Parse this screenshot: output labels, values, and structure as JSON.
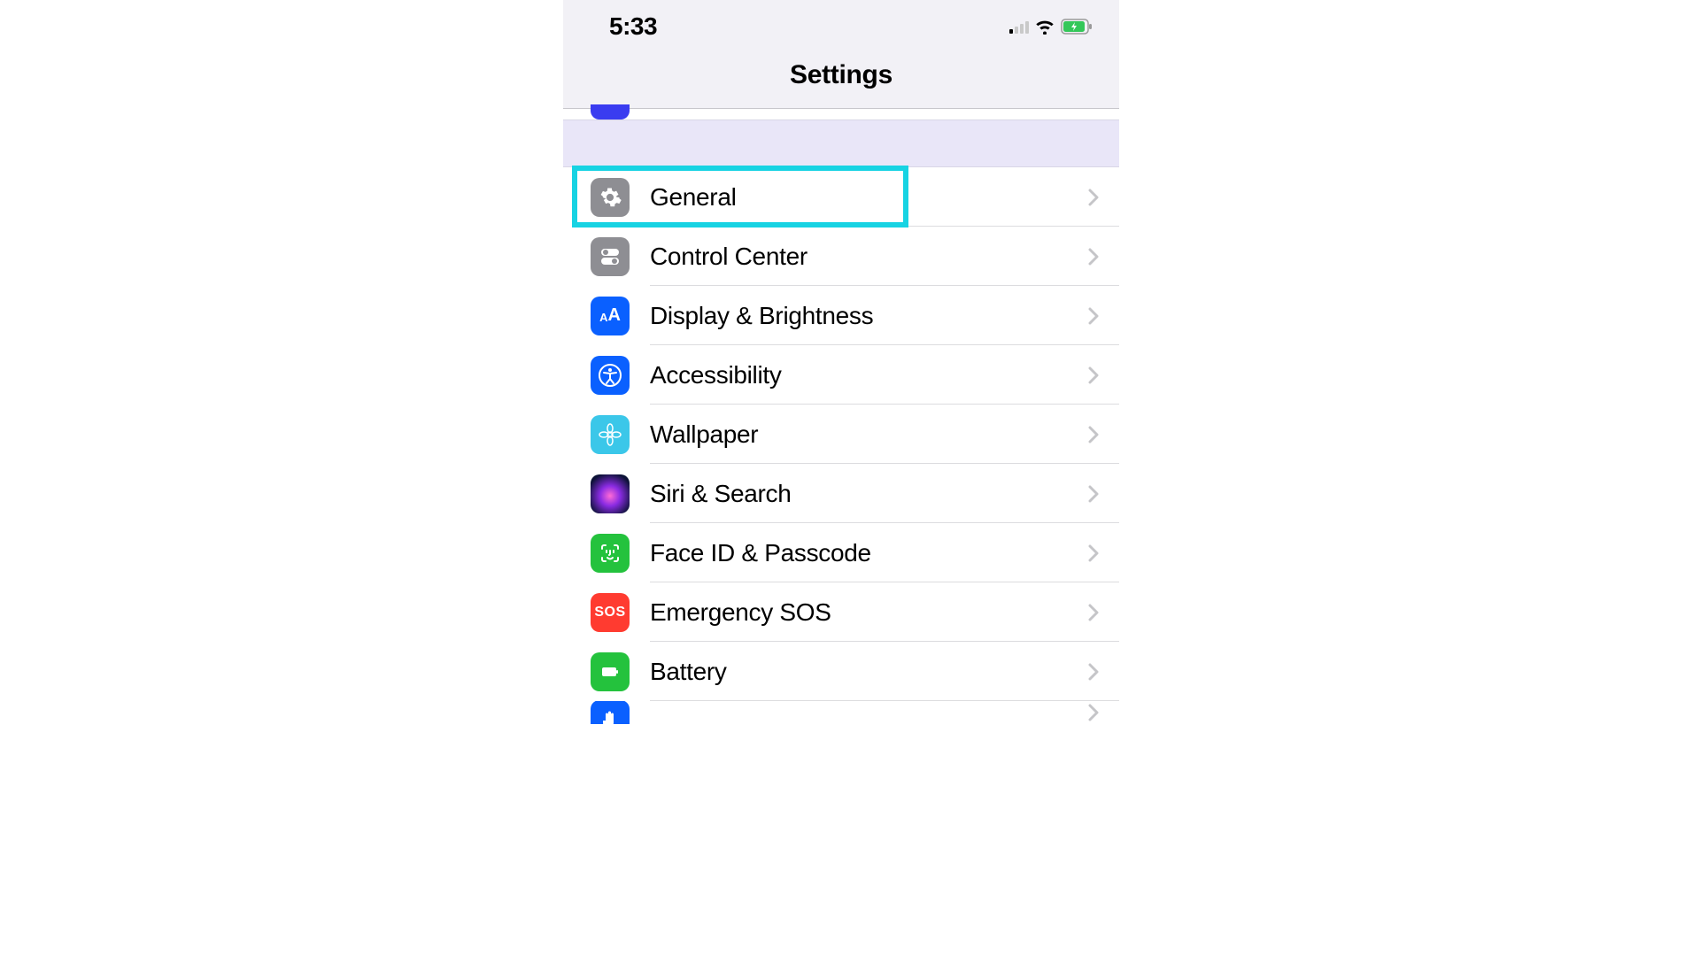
{
  "status": {
    "time": "5:33",
    "cell_active_bars": 1,
    "wifi_on": true,
    "battery_charging": true
  },
  "header": {
    "title": "Settings"
  },
  "highlighted_item": "general",
  "items": [
    {
      "id": "general",
      "label": "General",
      "icon": "gear-icon"
    },
    {
      "id": "control",
      "label": "Control Center",
      "icon": "switches-icon"
    },
    {
      "id": "display",
      "label": "Display & Brightness",
      "icon": "aa-icon"
    },
    {
      "id": "access",
      "label": "Accessibility",
      "icon": "accessibility-icon"
    },
    {
      "id": "wallpaper",
      "label": "Wallpaper",
      "icon": "flower-icon"
    },
    {
      "id": "siri",
      "label": "Siri & Search",
      "icon": "siri-icon"
    },
    {
      "id": "face",
      "label": "Face ID & Passcode",
      "icon": "face-id-icon"
    },
    {
      "id": "sos",
      "label": "Emergency SOS",
      "icon": "sos-icon",
      "icon_text": "SOS"
    },
    {
      "id": "battery",
      "label": "Battery",
      "icon": "battery-icon"
    },
    {
      "id": "privacy",
      "label": "",
      "icon": "hand-icon"
    }
  ],
  "display_icon_text": "AA"
}
